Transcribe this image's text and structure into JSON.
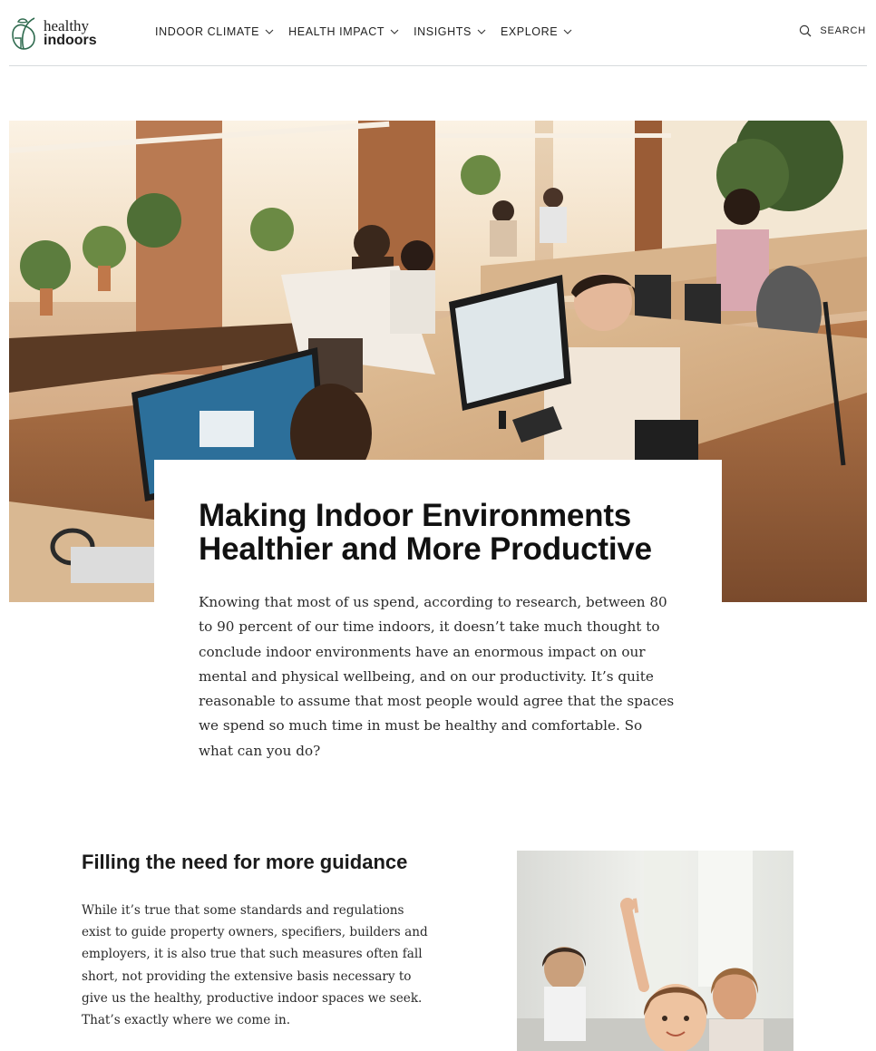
{
  "brand": {
    "line1": "healthy",
    "line2": "indoors",
    "color": "#2f6b4f"
  },
  "nav": {
    "items": [
      {
        "label": "INDOOR CLIMATE"
      },
      {
        "label": "HEALTH IMPACT"
      },
      {
        "label": "INSIGHTS"
      },
      {
        "label": "EXPLORE"
      }
    ],
    "search_label": "SEARCH"
  },
  "hero": {
    "image_icon": "office-photo",
    "title": "Making Indoor Environments Healthier and More Productive",
    "body": "Knowing that most of us spend, according to research, between 80 to 90 percent of our time indoors, it doesn’t take much thought to conclude indoor environments have an enormous impact on our mental and physical wellbeing, and on our productivity. It’s quite reasonable to assume that most people would agree that the spaces we spend so much time in must be healthy and comfortable. So what can you do?"
  },
  "section": {
    "title": "Filling the need for more guidance",
    "body": "While it’s true that some standards and regulations exist to guide property owners, specifiers, builders and employers, it is also true that such measures often fall short, not providing the extensive basis necessary to give us the healthy, productive indoor spaces we seek. That’s exactly where we come in.",
    "image_icon": "classroom-photo"
  }
}
